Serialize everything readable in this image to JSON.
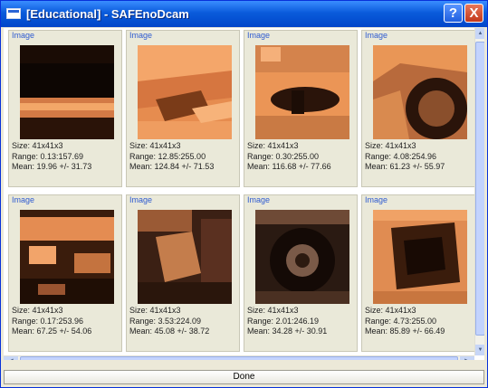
{
  "window": {
    "title": "[Educational] - SAFEnoDcam",
    "help_glyph": "?",
    "close_glyph": "X",
    "app_icon": "window-icon"
  },
  "thumbnails": [
    {
      "label": "Image",
      "size": "Size: 41x41x3",
      "range": "Range: 0.13:157.69",
      "mean": "Mean: 19.96 +/- 31.73"
    },
    {
      "label": "Image",
      "size": "Size: 41x41x3",
      "range": "Range: 12.85:255.00",
      "mean": "Mean: 124.84 +/- 71.53"
    },
    {
      "label": "Image",
      "size": "Size: 41x41x3",
      "range": "Range: 0.30:255.00",
      "mean": "Mean: 116.68 +/- 77.66"
    },
    {
      "label": "Image",
      "size": "Size: 41x41x3",
      "range": "Range: 4.08:254.96",
      "mean": "Mean: 61.23 +/- 55.97"
    },
    {
      "label": "Image",
      "size": "Size: 41x41x3",
      "range": "Range: 0.17:253.96",
      "mean": "Mean: 67.25 +/- 54.06"
    },
    {
      "label": "Image",
      "size": "Size: 41x41x3",
      "range": "Range: 3.53:224.09",
      "mean": "Mean: 45.08 +/- 38.72"
    },
    {
      "label": "Image",
      "size": "Size: 41x41x3",
      "range": "Range: 2.01:246.19",
      "mean": "Mean: 34.28 +/- 30.91"
    },
    {
      "label": "Image",
      "size": "Size: 41x41x3",
      "range": "Range: 4.73:255.00",
      "mean": "Mean: 85.89 +/- 66.49"
    }
  ],
  "scroll": {
    "up_glyph": "▲",
    "down_glyph": "▼",
    "left_glyph": "◀",
    "right_glyph": "▶"
  },
  "footer": {
    "done_label": "Done"
  },
  "colors": {
    "titlebar": "#0a5bdb",
    "cell_bg": "#eae9d9",
    "label_blue": "#2f5bd0",
    "thumb_orange": "#f09a58",
    "thumb_dark": "#2a1408"
  }
}
